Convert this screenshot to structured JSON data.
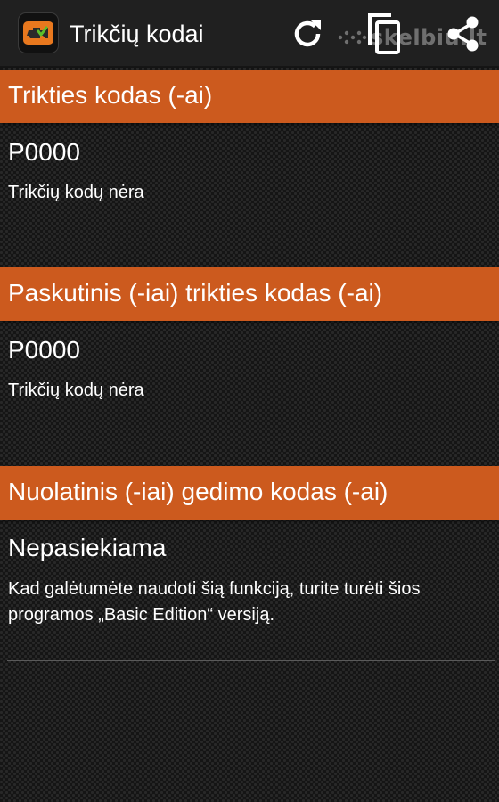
{
  "action_bar": {
    "title": "Trikčių kodai",
    "app_icon": "engine-check-icon",
    "actions": [
      {
        "name": "refresh",
        "icon": "refresh-icon"
      },
      {
        "name": "copy",
        "icon": "copy-icon"
      },
      {
        "name": "share",
        "icon": "share-icon"
      }
    ],
    "watermark": "skelbiu.lt"
  },
  "sections": [
    {
      "header": "Trikties kodas (-ai)",
      "code": "P0000",
      "description": "Trikčių kodų nėra"
    },
    {
      "header": "Paskutinis (-iai) trikties kodas (-ai)",
      "code": "P0000",
      "description": "Trikčių kodų nėra"
    },
    {
      "header": "Nuolatinis (-iai) gedimo kodas (-ai)",
      "code": "Nepasiekiama",
      "description": "Kad galėtumėte naudoti šią funkciją, turite turėti šios programos „Basic Edition“ versiją."
    }
  ],
  "colors": {
    "accent": "#cc5a1e",
    "action_bar": "#202020",
    "background": "#1c1c1c",
    "text": "#ffffff"
  }
}
